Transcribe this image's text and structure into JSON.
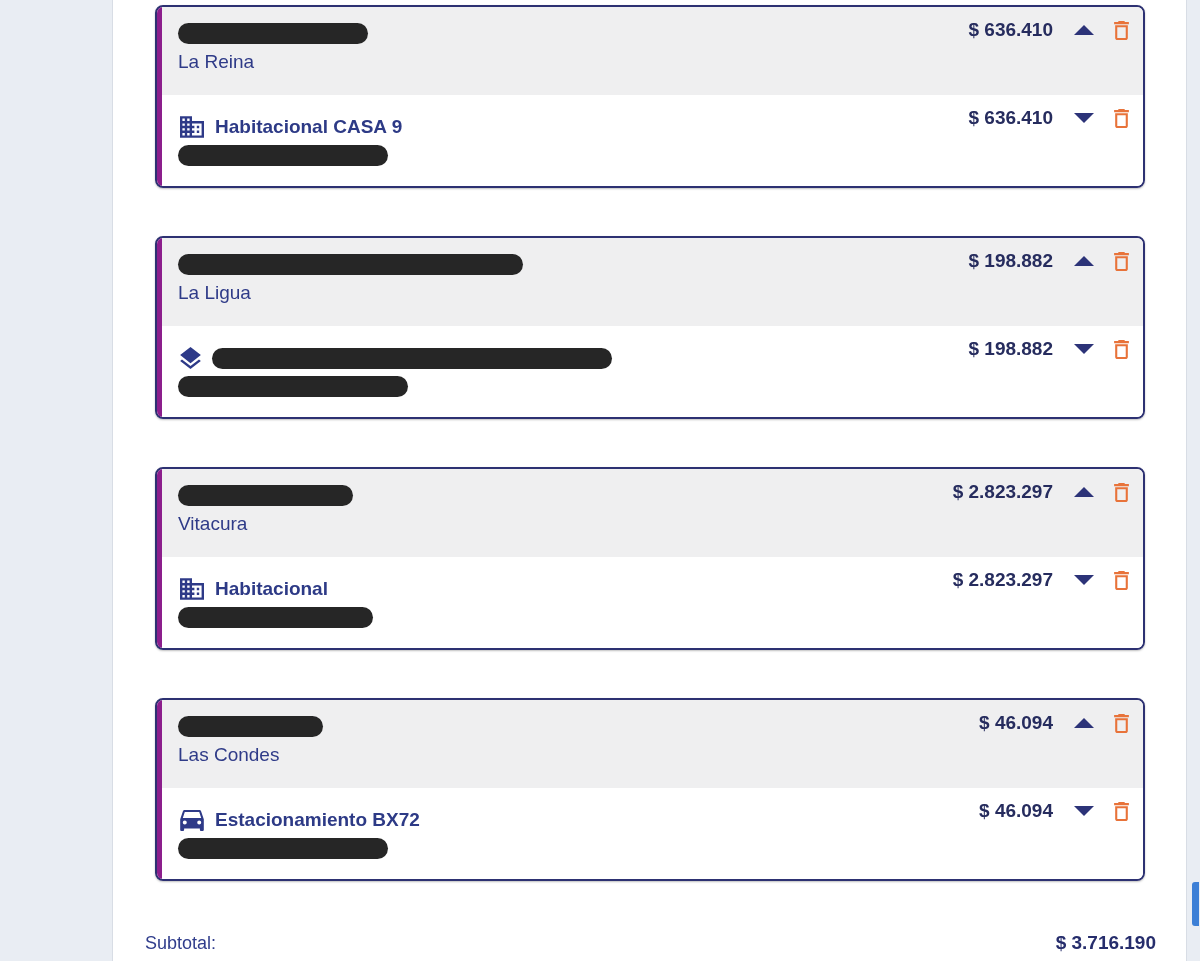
{
  "properties": [
    {
      "address_redacted": true,
      "commune": "La Reina",
      "amount": "$ 636.410",
      "expanded": true,
      "units": [
        {
          "kind": "building",
          "title": "Habitacional CASA 9",
          "rol_redacted": true,
          "amount": "$ 636.410",
          "expanded": false
        }
      ]
    },
    {
      "address_redacted": true,
      "commune": "La Ligua",
      "amount": "$ 198.882",
      "expanded": true,
      "units": [
        {
          "kind": "layers",
          "title_redacted": true,
          "rol_redacted": true,
          "amount": "$ 198.882",
          "expanded": false
        }
      ]
    },
    {
      "address_redacted": true,
      "commune": "Vitacura",
      "amount": "$ 2.823.297",
      "expanded": true,
      "units": [
        {
          "kind": "building",
          "title": "Habitacional",
          "rol_redacted": true,
          "amount": "$ 2.823.297",
          "expanded": false
        }
      ]
    },
    {
      "address_redacted": true,
      "commune": "Las Condes",
      "amount": "$ 46.094",
      "expanded": true,
      "units": [
        {
          "kind": "car",
          "title": "Estacionamiento BX72",
          "rol_redacted": true,
          "amount": "$ 46.094",
          "expanded": false
        }
      ]
    }
  ],
  "subtotal": {
    "label": "Subtotal:",
    "amount": "$ 3.716.190"
  }
}
